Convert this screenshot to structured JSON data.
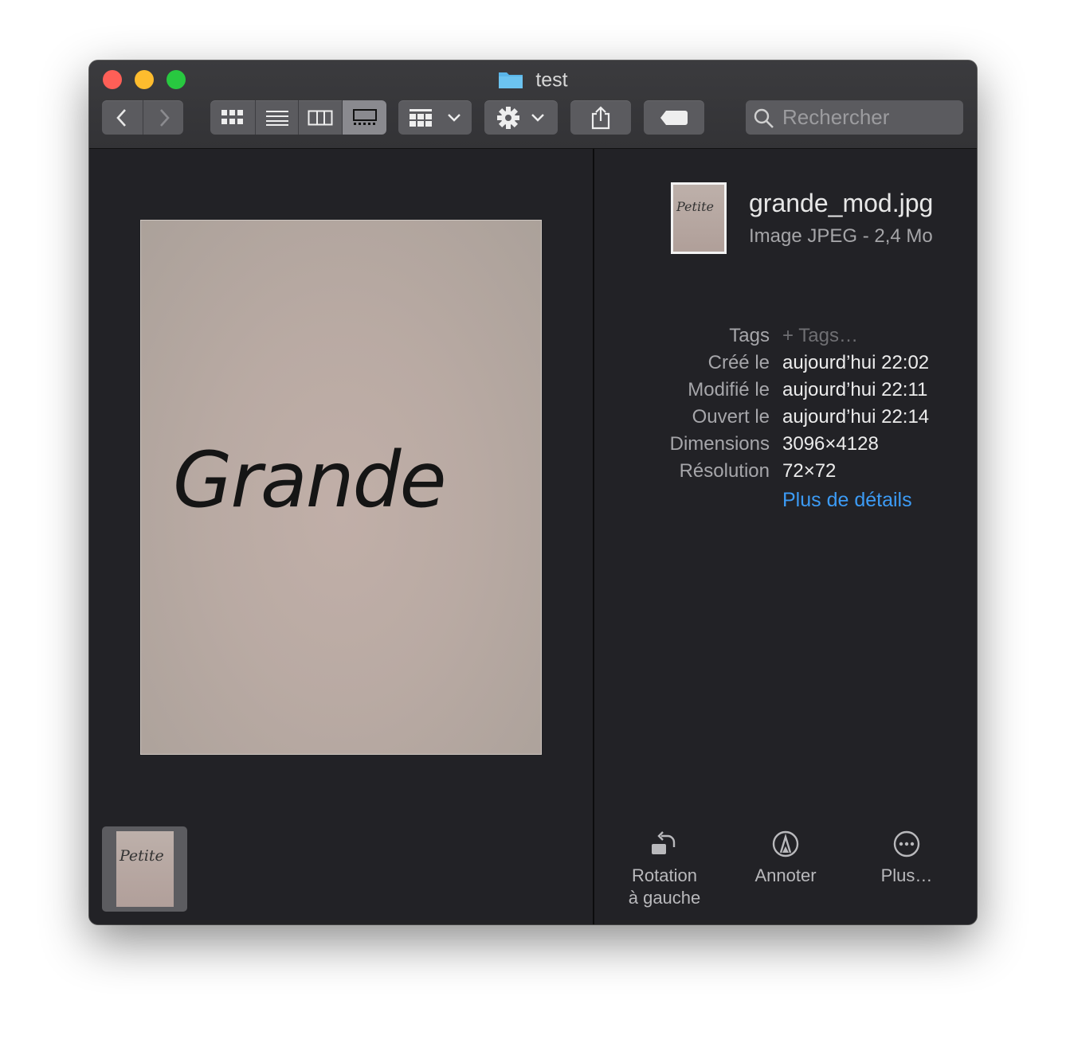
{
  "window": {
    "title": "test"
  },
  "toolbar": {
    "back_icon": "chevron-left-icon",
    "forward_icon": "chevron-right-icon",
    "view_modes": [
      "icons-view-icon",
      "list-view-icon",
      "columns-view-icon",
      "gallery-view-icon"
    ],
    "selected_view": "gallery-view-icon",
    "group_icon": "group-by-icon",
    "action_icon": "gear-icon",
    "share_icon": "share-icon",
    "tag_icon": "tag-icon",
    "search": {
      "placeholder": "Rechercher"
    }
  },
  "gallery": {
    "preview_text": "Grande",
    "filmstrip": [
      {
        "thumb_text": "Petite"
      }
    ]
  },
  "inspector": {
    "filename": "grande_mod.jpg",
    "filetype": "Image JPEG - 2,4 Mo",
    "thumb_text": "Petite",
    "metadata": [
      {
        "key": "Tags",
        "value": "+ Tags…"
      },
      {
        "key": "Créé le",
        "value": "aujourd’hui 22:02"
      },
      {
        "key": "Modifié le",
        "value": "aujourd’hui 22:11"
      },
      {
        "key": "Ouvert le",
        "value": "aujourd’hui 22:14"
      },
      {
        "key": "Dimensions",
        "value": "3096×4128"
      },
      {
        "key": "Résolution",
        "value": "72×72"
      }
    ],
    "more_details": "Plus de détails",
    "actions": [
      {
        "line1": "Rotation",
        "line2": "à gauche",
        "icon": "rotate-left-icon"
      },
      {
        "line1": "Annoter",
        "line2": "",
        "icon": "markup-icon"
      },
      {
        "line1": "Plus…",
        "line2": "",
        "icon": "more-icon"
      }
    ]
  },
  "colors": {
    "accent": "#3c9bf5",
    "window_bg": "#222226",
    "toolbar_bg": "#5b5b5f"
  }
}
